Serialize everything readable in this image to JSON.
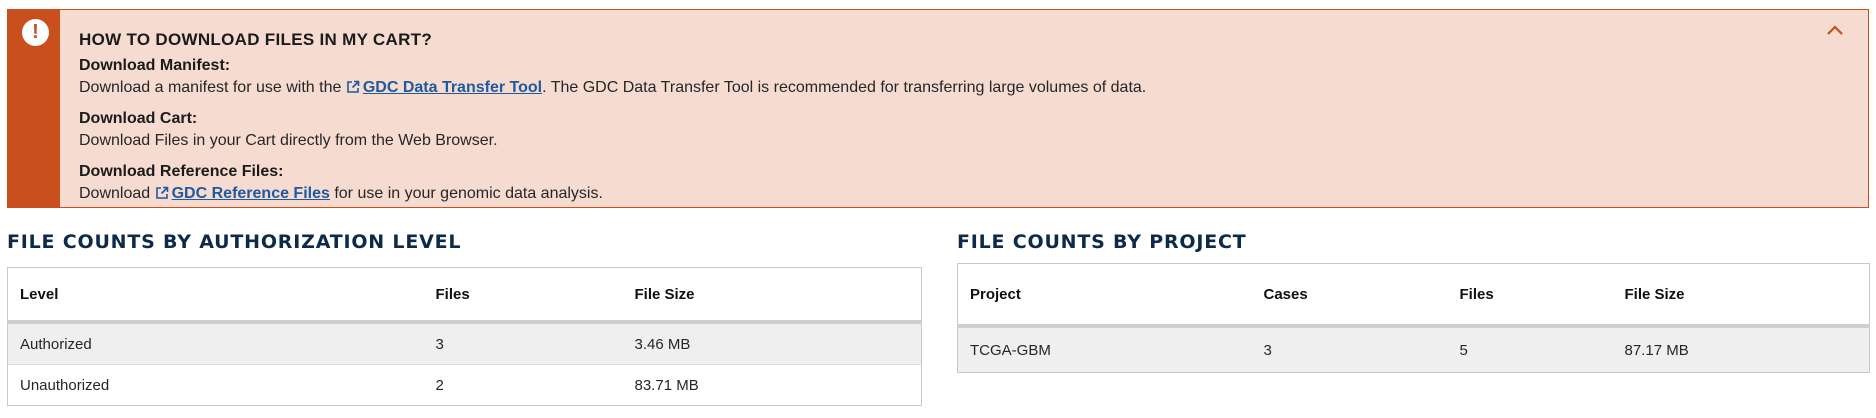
{
  "banner": {
    "title": "HOW TO DOWNLOAD FILES IN MY CART?",
    "manifest": {
      "heading": "Download Manifest:",
      "text_before": "Download a manifest for use with the ",
      "link": "GDC Data Transfer Tool",
      "text_after": ". The GDC Data Transfer Tool is recommended for transferring large volumes of data."
    },
    "cart": {
      "heading": "Download Cart:",
      "text": "Download Files in your Cart directly from the Web Browser."
    },
    "reference": {
      "heading": "Download Reference Files:",
      "text_before": "Download ",
      "link": "GDC Reference Files",
      "text_after": " for use in your genomic data analysis."
    },
    "icons": {
      "alert": "exclamation-circle-icon",
      "collapse": "chevron-up-icon",
      "external": "external-link-icon"
    },
    "colors": {
      "accent": "#c9501c",
      "background": "#f6dbd0",
      "link": "#1f5aa0"
    }
  },
  "auth_panel": {
    "title": "FILE COUNTS BY AUTHORIZATION LEVEL",
    "headers": {
      "level": "Level",
      "files": "Files",
      "size": "File Size"
    },
    "rows": [
      {
        "level": "Authorized",
        "files": "3",
        "size": "3.46 MB"
      },
      {
        "level": "Unauthorized",
        "files": "2",
        "size": "83.71 MB"
      }
    ]
  },
  "project_panel": {
    "title": "FILE COUNTS BY PROJECT",
    "headers": {
      "project": "Project",
      "cases": "Cases",
      "files": "Files",
      "size": "File Size"
    },
    "rows": [
      {
        "project": "TCGA-GBM",
        "cases": "3",
        "files": "5",
        "size": "87.17 MB"
      }
    ]
  }
}
